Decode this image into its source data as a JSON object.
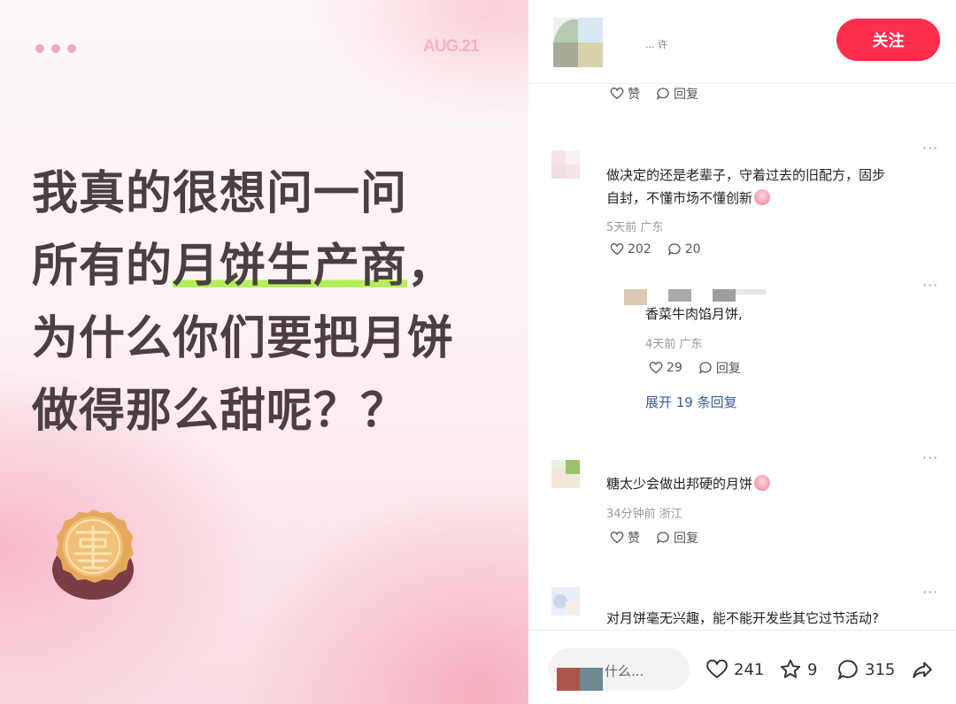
{
  "post": {
    "date": "AUG.21",
    "headline_lines": {
      "l1": "我真的很想问一问",
      "l2_pre": "所有的",
      "l2_hl": "月饼生产商",
      "l2_post": "，",
      "l3": "为什么你们要把月饼",
      "l4": "做得那么甜呢？？"
    }
  },
  "header": {
    "author": "... 许",
    "follow_label": "关注"
  },
  "comments": [
    {
      "like_label": "赞",
      "reply_label": "回复"
    },
    {
      "text_line1": "做决定的还是老辈子，守着过去的旧配方，固步",
      "text_line2": "自封，不懂市场不懂创新",
      "meta": "5天前 广东",
      "likes": "202",
      "replies": "20",
      "more": "···"
    },
    {
      "text": "香菜牛肉馅月饼,",
      "meta": "4天前 广东",
      "likes": "29",
      "reply_label": "回复",
      "expand": "展开 19 条回复",
      "more": "···"
    },
    {
      "text": "糖太少会做出邦硬的月饼",
      "meta": "34分钟前 浙江",
      "like_label": "赞",
      "reply_label": "回复",
      "more": "···"
    },
    {
      "text": "对月饼毫无兴趣，能不能开发些其它过节活动?",
      "more": "···"
    }
  ],
  "bottom": {
    "input_placeholder": "什么...",
    "likes": "241",
    "stars": "9",
    "comments": "315"
  },
  "colors": {
    "accent": "#ff2e4d",
    "link": "#3b5d97",
    "highlight": "#b3ee5c",
    "headline": "#4b3f43"
  }
}
